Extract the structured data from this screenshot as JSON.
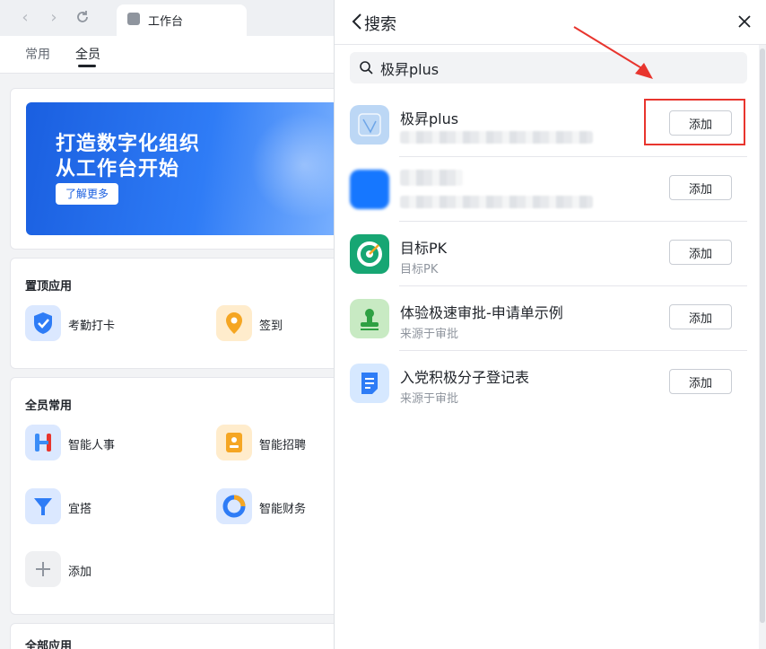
{
  "browser": {
    "tab_title": "工作台"
  },
  "workbench": {
    "tabs": [
      "常用",
      "全员"
    ],
    "active_tab": "全员",
    "banner": {
      "line1": "打造数字化组织",
      "line2": "从工作台开始",
      "button": "了解更多"
    },
    "pinned": {
      "title": "置顶应用",
      "apps": [
        {
          "label": "考勤打卡",
          "icon": "check-shield-icon",
          "color": "#2e7cf6"
        },
        {
          "label": "签到",
          "icon": "location-pin-icon",
          "color": "#f5a623"
        }
      ]
    },
    "common": {
      "title": "全员常用",
      "apps": [
        {
          "label": "智能人事",
          "icon": "h-logo-icon",
          "color": "#3a8cf7"
        },
        {
          "label": "智能招聘",
          "icon": "recruit-badge-icon",
          "color": "#f5a623"
        },
        {
          "label": "宜搭",
          "icon": "yida-logo-icon",
          "color": "#2e7cf6"
        },
        {
          "label": "智能财务",
          "icon": "finance-ring-icon",
          "color": "#2e7cf6"
        },
        {
          "label": "添加",
          "icon": "plus-icon",
          "color": "#8f959e"
        }
      ]
    },
    "all_apps": {
      "title": "全部应用"
    }
  },
  "search_panel": {
    "title": "搜索",
    "query": "极昇plus",
    "add_label": "添加",
    "results": [
      {
        "name": "极昇plus",
        "desc": "",
        "icon": "jisheng-logo-icon",
        "color": "#bcd7f5",
        "blurred_desc": true
      },
      {
        "name": "",
        "desc": "",
        "icon": "blurred-app-icon",
        "color": "#1677ff",
        "blurred_name": true,
        "blurred_desc": true
      },
      {
        "name": "目标PK",
        "desc": "目标PK",
        "icon": "target-icon",
        "color": "#17a673"
      },
      {
        "name": "体验极速审批-申请单示例",
        "desc": "来源于审批",
        "icon": "approval-stamp-icon",
        "color": "#c8eac3"
      },
      {
        "name": "入党积极分子登记表",
        "desc": "来源于审批",
        "icon": "form-doc-icon",
        "color": "#d6e8ff"
      }
    ]
  },
  "colors": {
    "accent": "#2e7cf6",
    "highlight": "#e8352e"
  }
}
